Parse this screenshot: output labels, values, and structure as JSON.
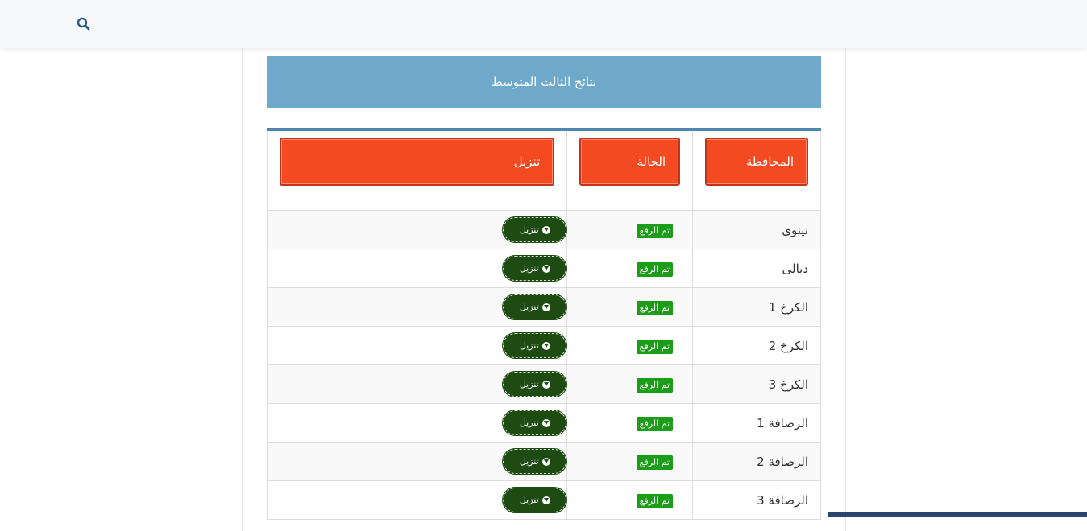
{
  "header": {
    "search_icon": "search-icon"
  },
  "title": "نتائج الثالث المتوسط",
  "table": {
    "headers": {
      "governorate": "المحافظة",
      "status": "الحالة",
      "download": "تنزيل"
    },
    "rows": [
      {
        "governorate": "نينوى",
        "status": "تم الرفع",
        "download": "تنزيل"
      },
      {
        "governorate": "ديالى",
        "status": "تم الرفع",
        "download": "تنزيل"
      },
      {
        "governorate": "الكرخ 1",
        "status": "تم الرفع",
        "download": "تنزيل"
      },
      {
        "governorate": "الكرخ 2",
        "status": "تم الرفع",
        "download": "تنزيل"
      },
      {
        "governorate": "الكرخ 3",
        "status": "تم الرفع",
        "download": "تنزيل"
      },
      {
        "governorate": "الرصافة 1",
        "status": "تم الرفع",
        "download": "تنزيل"
      },
      {
        "governorate": "الرصافة 2",
        "status": "تم الرفع",
        "download": "تنزيل"
      },
      {
        "governorate": "الرصافة 3",
        "status": "تم الرفع",
        "download": "تنزيل"
      }
    ]
  },
  "colors": {
    "title_bg": "#6ea9cc",
    "header_cell_bg": "#f44a22",
    "badge_bg": "#1c9c19",
    "download_btn_bg": "#1d4b12",
    "table_top_border": "#4a86b0"
  }
}
